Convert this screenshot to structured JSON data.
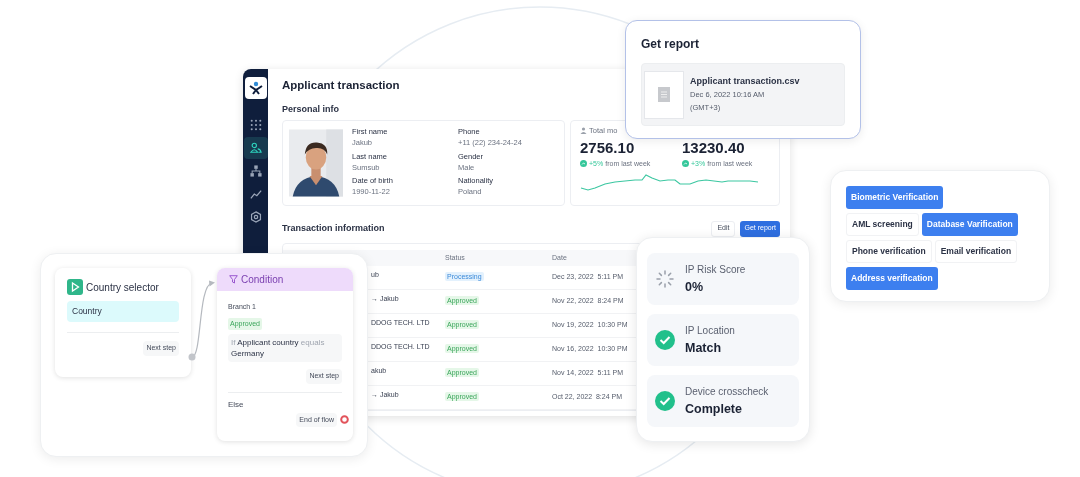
{
  "dashboard": {
    "title": "Applicant transaction",
    "sidebar": [
      {
        "kind": "grid",
        "selected": false
      },
      {
        "kind": "people",
        "selected": true
      },
      {
        "kind": "tree",
        "selected": false
      },
      {
        "kind": "chart",
        "selected": false
      },
      {
        "kind": "gear",
        "selected": false
      }
    ],
    "personal_info": {
      "heading": "Personal info",
      "fields": [
        {
          "label": "First name",
          "value": "Jakub"
        },
        {
          "label": "Last name",
          "value": "Sumsub"
        },
        {
          "label": "Date of birth",
          "value": "1990-11-22"
        },
        {
          "label": "Phone",
          "value": "+11 (22) 234-24-24"
        },
        {
          "label": "Gender",
          "value": "Male"
        },
        {
          "label": "Nationality",
          "value": "Poland"
        }
      ]
    },
    "stats": {
      "label": "Total mo",
      "metrics": [
        {
          "value": "2756.10",
          "change": "+5%",
          "note": "from last week"
        },
        {
          "value": "13230.40",
          "change": "+3%",
          "note": "from last week"
        }
      ]
    },
    "transactions": {
      "heading": "Transaction information",
      "buttons": [
        {
          "label": "Edit",
          "kind": "secondary"
        },
        {
          "label": "Get report",
          "kind": "primary"
        }
      ],
      "columns": {
        "column_2": "Status",
        "column_3": "Date"
      },
      "rows": [
        {
          "column_1": "ub",
          "status": "Processing",
          "kind": "processing",
          "date": "Dec 23, 2022  5:11 PM"
        },
        {
          "column_1": "→ Jakub",
          "status": "Approved",
          "kind": "approved",
          "date": "Nov 22, 2022  8:24 PM"
        },
        {
          "column_1": "DDOG TECH. LTD",
          "status": "Approved",
          "kind": "approved",
          "date": "Nov 19, 2022  10:30 PM"
        },
        {
          "column_1": "DDOG TECH. LTD",
          "status": "Approved",
          "kind": "approved",
          "date": "Nov 16, 2022  10:30 PM"
        },
        {
          "column_1": "akub",
          "status": "Approved",
          "kind": "approved",
          "date": "Nov 14, 2022  5:11 PM"
        },
        {
          "column_1": "→ Jakub",
          "status": "Approved",
          "kind": "approved",
          "date": "Oct 22, 2022  8:24 PM"
        }
      ]
    }
  },
  "report": {
    "title": "Get report",
    "file": {
      "name": "Applicant transaction.csv",
      "date": "Dec 6, 2022 10:16 AM",
      "timezone": "(GMT+3)"
    }
  },
  "flow": {
    "source": {
      "title": "Country selector",
      "field": "Country",
      "next": "Next step"
    },
    "condition": {
      "title": "Condition",
      "branch": "Branch 1",
      "badge": "Approved",
      "rule": {
        "prefix": "If",
        "field": "Applicant country",
        "operator": "equals",
        "value": "Germany"
      },
      "next": "Next step",
      "else": "Else",
      "end": "End of flow"
    }
  },
  "checks": [
    {
      "label": "IP Risk Score",
      "value": "0%",
      "kind": "pending"
    },
    {
      "label": "IP Location",
      "value": "Match",
      "kind": "passed"
    },
    {
      "label": "Device crosscheck",
      "value": "Complete",
      "kind": "passed"
    }
  ],
  "verifications": [
    [
      {
        "label": "Biometric Verification",
        "selected": true
      }
    ],
    [
      {
        "label": "AML screening",
        "selected": false
      },
      {
        "label": "Database Varification",
        "selected": true
      }
    ],
    [
      {
        "label": "Phone verification",
        "selected": false
      },
      {
        "label": "Email verification",
        "selected": false
      }
    ],
    [
      {
        "label": "Address verification",
        "selected": true
      }
    ]
  ]
}
